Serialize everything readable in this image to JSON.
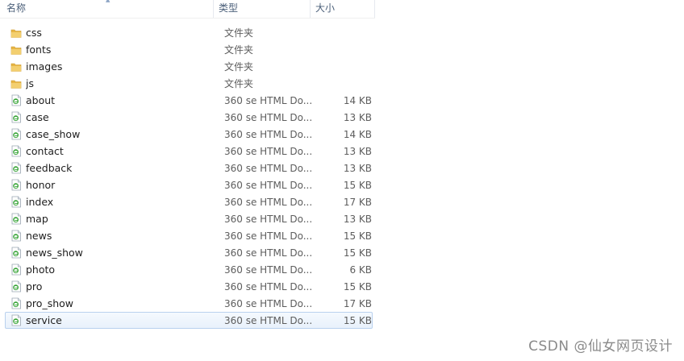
{
  "header": {
    "name_label": "名称",
    "type_label": "类型",
    "size_label": "大小"
  },
  "files": [
    {
      "name": "css",
      "type": "文件夹",
      "size": "",
      "icon": "folder-icon",
      "selected": false
    },
    {
      "name": "fonts",
      "type": "文件夹",
      "size": "",
      "icon": "folder-icon",
      "selected": false
    },
    {
      "name": "images",
      "type": "文件夹",
      "size": "",
      "icon": "folder-icon",
      "selected": false
    },
    {
      "name": "js",
      "type": "文件夹",
      "size": "",
      "icon": "folder-icon",
      "selected": false
    },
    {
      "name": "about",
      "type": "360 se HTML Do...",
      "size": "14 KB",
      "icon": "html-file-icon",
      "selected": false
    },
    {
      "name": "case",
      "type": "360 se HTML Do...",
      "size": "13 KB",
      "icon": "html-file-icon",
      "selected": false
    },
    {
      "name": "case_show",
      "type": "360 se HTML Do...",
      "size": "14 KB",
      "icon": "html-file-icon",
      "selected": false
    },
    {
      "name": "contact",
      "type": "360 se HTML Do...",
      "size": "13 KB",
      "icon": "html-file-icon",
      "selected": false
    },
    {
      "name": "feedback",
      "type": "360 se HTML Do...",
      "size": "13 KB",
      "icon": "html-file-icon",
      "selected": false
    },
    {
      "name": "honor",
      "type": "360 se HTML Do...",
      "size": "15 KB",
      "icon": "html-file-icon",
      "selected": false
    },
    {
      "name": "index",
      "type": "360 se HTML Do...",
      "size": "17 KB",
      "icon": "html-file-icon",
      "selected": false
    },
    {
      "name": "map",
      "type": "360 se HTML Do...",
      "size": "13 KB",
      "icon": "html-file-icon",
      "selected": false
    },
    {
      "name": "news",
      "type": "360 se HTML Do...",
      "size": "15 KB",
      "icon": "html-file-icon",
      "selected": false
    },
    {
      "name": "news_show",
      "type": "360 se HTML Do...",
      "size": "15 KB",
      "icon": "html-file-icon",
      "selected": false
    },
    {
      "name": "photo",
      "type": "360 se HTML Do...",
      "size": "6 KB",
      "icon": "html-file-icon",
      "selected": false
    },
    {
      "name": "pro",
      "type": "360 se HTML Do...",
      "size": "15 KB",
      "icon": "html-file-icon",
      "selected": false
    },
    {
      "name": "pro_show",
      "type": "360 se HTML Do...",
      "size": "17 KB",
      "icon": "html-file-icon",
      "selected": false
    },
    {
      "name": "service",
      "type": "360 se HTML Do...",
      "size": "15 KB",
      "icon": "html-file-icon",
      "selected": true
    }
  ],
  "watermark": "CSDN @仙女网页设计",
  "colors": {
    "folder": "#e8b646",
    "html_icon": "#3aa53a",
    "selection_border": "#b9d1ee",
    "header_text": "#4c607a"
  }
}
